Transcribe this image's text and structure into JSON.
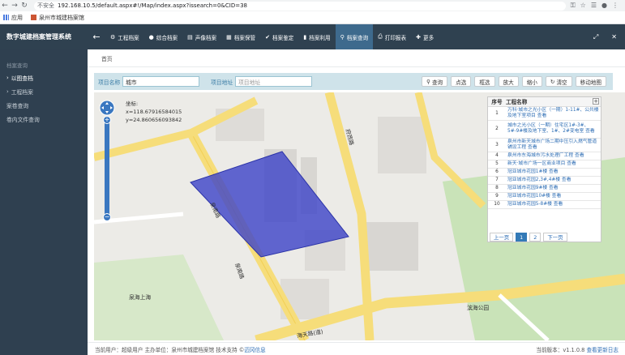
{
  "browser": {
    "security_label": "不安全",
    "url": "192.168.10.5/default.aspx#!/Map/index.aspx?issearch=0&CID=38",
    "bookmarks": [
      {
        "label": "应用"
      },
      {
        "label": "泉州市城建档案馆"
      }
    ]
  },
  "header": {
    "title": "数字城建档案管理系统",
    "menu": [
      {
        "label": "工程档案",
        "icon": "⚙"
      },
      {
        "label": "综合档案",
        "icon": "●"
      },
      {
        "label": "声像档案",
        "icon": "▤"
      },
      {
        "label": "档案保管",
        "icon": "▦"
      },
      {
        "label": "档案鉴定",
        "icon": "✔"
      },
      {
        "label": "档案利用",
        "icon": "▮"
      },
      {
        "label": "档案查询",
        "icon": "🔍"
      },
      {
        "label": "打印报表",
        "icon": "⎙"
      },
      {
        "label": "更多",
        "icon": "✚"
      }
    ],
    "active_menu": "档案查询"
  },
  "sidebar": {
    "section_title": "档案查询",
    "items": [
      {
        "label": "以图查档",
        "active": true
      },
      {
        "label": "工程档案",
        "active": false
      },
      {
        "label": "案卷查询",
        "active": false
      },
      {
        "label": "卷内文件查询",
        "active": false
      }
    ]
  },
  "breadcrumb": {
    "home": "首页"
  },
  "search": {
    "project_name_label": "项目名称",
    "project_name_value": "城市",
    "project_address_label": "项目地址",
    "project_address_value": "",
    "project_address_placeholder": "项目地址",
    "buttons": [
      "查询",
      "点选",
      "框选",
      "放大",
      "缩小",
      "清空",
      "移动地图"
    ]
  },
  "map": {
    "coord_label": "坐标:",
    "x_label": "x=118.67916584015",
    "y_label": "y=24.860656093842",
    "labels": [
      "泉南路",
      "泉南路",
      "府西路",
      "泉海上海",
      "滨海公园",
      "海天路(道)"
    ],
    "polygon_color": "#3f46c8"
  },
  "results": {
    "columns": [
      "序号",
      "工程名称"
    ],
    "rows": [
      {
        "idx": "1",
        "name": "万科·城市之光小区（一期）1-11#、公共楼及地下室项目",
        "view": "查看"
      },
      {
        "idx": "2",
        "name": "城市之光小区（一期）住宅区1#-3#、5#-9#楼及地下室、1#、2#变电室",
        "view": "查看"
      },
      {
        "idx": "3",
        "name": "泉州市新天城市广场二期中压引入燃气管道铺设工程",
        "view": "查看"
      },
      {
        "idx": "4",
        "name": "泉州市东海城市污水处理厂工程",
        "view": "查看"
      },
      {
        "idx": "5",
        "name": "新天·城市广场一区商业项目",
        "view": "查看"
      },
      {
        "idx": "6",
        "name": "冠亚城市花园1#楼",
        "view": "查看"
      },
      {
        "idx": "7",
        "name": "冠亚城市花园2,3#,4#楼",
        "view": "查看"
      },
      {
        "idx": "8",
        "name": "冠亚城市花园9#楼",
        "view": "查看"
      },
      {
        "idx": "9",
        "name": "冠亚城市花园10#楼",
        "view": "查看"
      },
      {
        "idx": "10",
        "name": "冠亚城市花园5-8#楼",
        "view": "查看"
      }
    ],
    "pager": {
      "prev": "上一页",
      "pages": [
        "1",
        "2"
      ],
      "current": "1",
      "next": "下一页"
    }
  },
  "footer": {
    "user_text": "当前用户：超级用户 主办单位：泉州市城建档案馆 技术支持 ©",
    "support_link": "迈冈信息",
    "version_text": "当前版本：v1.1.0.8",
    "changelog_link": "查看更新日志"
  }
}
